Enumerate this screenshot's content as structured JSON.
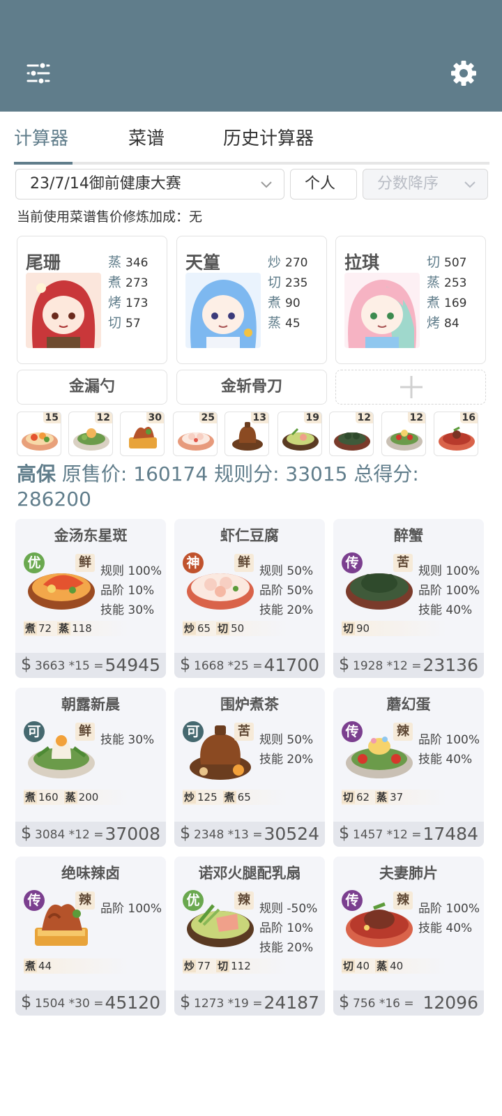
{
  "tabs": [
    "计算器",
    "菜谱",
    "历史计算器"
  ],
  "filters": {
    "contest": "23/7/14御前健康大赛",
    "mode": "个人",
    "sort": "分数降序"
  },
  "note": "当前使用菜谱售价修炼加成：无",
  "chefs": [
    {
      "name": "尾珊",
      "skills": [
        {
          "k": "蒸",
          "v": "346"
        },
        {
          "k": "煮",
          "v": "273"
        },
        {
          "k": "烤",
          "v": "173"
        },
        {
          "k": "切",
          "v": "57"
        }
      ]
    },
    {
      "name": "天篁",
      "skills": [
        {
          "k": "炒",
          "v": "270"
        },
        {
          "k": "切",
          "v": "235"
        },
        {
          "k": "煮",
          "v": "90"
        },
        {
          "k": "蒸",
          "v": "45"
        }
      ]
    },
    {
      "name": "拉琪",
      "skills": [
        {
          "k": "切",
          "v": "507"
        },
        {
          "k": "蒸",
          "v": "253"
        },
        {
          "k": "煮",
          "v": "169"
        },
        {
          "k": "烤",
          "v": "84"
        }
      ]
    }
  ],
  "tools": [
    "金漏勺",
    "金斩骨刀"
  ],
  "thumb_quantities": [
    "15",
    "12",
    "30",
    "25",
    "13",
    "19",
    "12",
    "12",
    "16"
  ],
  "summary": {
    "strategy": "高保",
    "price_label": "原售价:",
    "price": "160174",
    "rule_label": "规则分:",
    "rule": "33015",
    "total_label": "总得分:",
    "total": "286200"
  },
  "results": [
    {
      "name": "金汤东星斑",
      "rank": "优",
      "flavor": "鲜",
      "bonus": [
        "规则 100%",
        "品阶 10%",
        "技能 30%"
      ],
      "req": [
        {
          "k": "煮",
          "v": "72"
        },
        {
          "k": "蒸",
          "v": "118"
        }
      ],
      "price": "3663",
      "qty": "*15",
      "total": "54945"
    },
    {
      "name": "虾仁豆腐",
      "rank": "神",
      "flavor": "鲜",
      "bonus": [
        "规则 50%",
        "品阶 50%",
        "技能 20%"
      ],
      "req": [
        {
          "k": "炒",
          "v": "65"
        },
        {
          "k": "切",
          "v": "50"
        }
      ],
      "price": "1668",
      "qty": "*25",
      "total": "41700"
    },
    {
      "name": "醉蟹",
      "rank": "传",
      "flavor": "苦",
      "bonus": [
        "规则 100%",
        "品阶 100%",
        "技能 40%"
      ],
      "req": [
        {
          "k": "切",
          "v": "90"
        }
      ],
      "price": "1928",
      "qty": "*12",
      "total": "23136"
    },
    {
      "name": "朝露新晨",
      "rank": "可",
      "flavor": "鲜",
      "bonus": [
        "技能 30%"
      ],
      "req": [
        {
          "k": "煮",
          "v": "160"
        },
        {
          "k": "蒸",
          "v": "200"
        }
      ],
      "price": "3084",
      "qty": "*12",
      "total": "37008"
    },
    {
      "name": "围炉煮茶",
      "rank": "可",
      "flavor": "苦",
      "bonus": [
        "规则 50%",
        "技能 20%"
      ],
      "req": [
        {
          "k": "炒",
          "v": "125"
        },
        {
          "k": "煮",
          "v": "65"
        }
      ],
      "price": "2348",
      "qty": "*13",
      "total": "30524"
    },
    {
      "name": "蘑幻蛋",
      "rank": "传",
      "flavor": "辣",
      "bonus": [
        "品阶 100%",
        "技能 40%"
      ],
      "req": [
        {
          "k": "切",
          "v": "62"
        },
        {
          "k": "蒸",
          "v": "37"
        }
      ],
      "price": "1457",
      "qty": "*12",
      "total": "17484"
    },
    {
      "name": "绝味辣卤",
      "rank": "传",
      "flavor": "辣",
      "bonus": [
        "品阶 100%"
      ],
      "req": [
        {
          "k": "煮",
          "v": "44"
        }
      ],
      "price": "1504",
      "qty": "*30",
      "total": "45120"
    },
    {
      "name": "诺邓火腿配乳扇",
      "rank": "优",
      "flavor": "辣",
      "bonus": [
        "规则 -50%",
        "品阶 10%",
        "技能 20%"
      ],
      "req": [
        {
          "k": "炒",
          "v": "77"
        },
        {
          "k": "切",
          "v": "112"
        }
      ],
      "price": "1273",
      "qty": "*19",
      "total": "24187"
    },
    {
      "name": "夫妻肺片",
      "rank": "传",
      "flavor": "辣",
      "bonus": [
        "品阶 100%",
        "技能 40%"
      ],
      "req": [
        {
          "k": "切",
          "v": "40"
        },
        {
          "k": "蒸",
          "v": "40"
        }
      ],
      "price": "756",
      "qty": "*16",
      "total": "12096"
    }
  ],
  "colors": {
    "primary": "#607d8b",
    "rank_优": "#6aa84f",
    "rank_神": "#c0522d",
    "rank_传": "#7b3f8f",
    "rank_可": "#45686f"
  }
}
